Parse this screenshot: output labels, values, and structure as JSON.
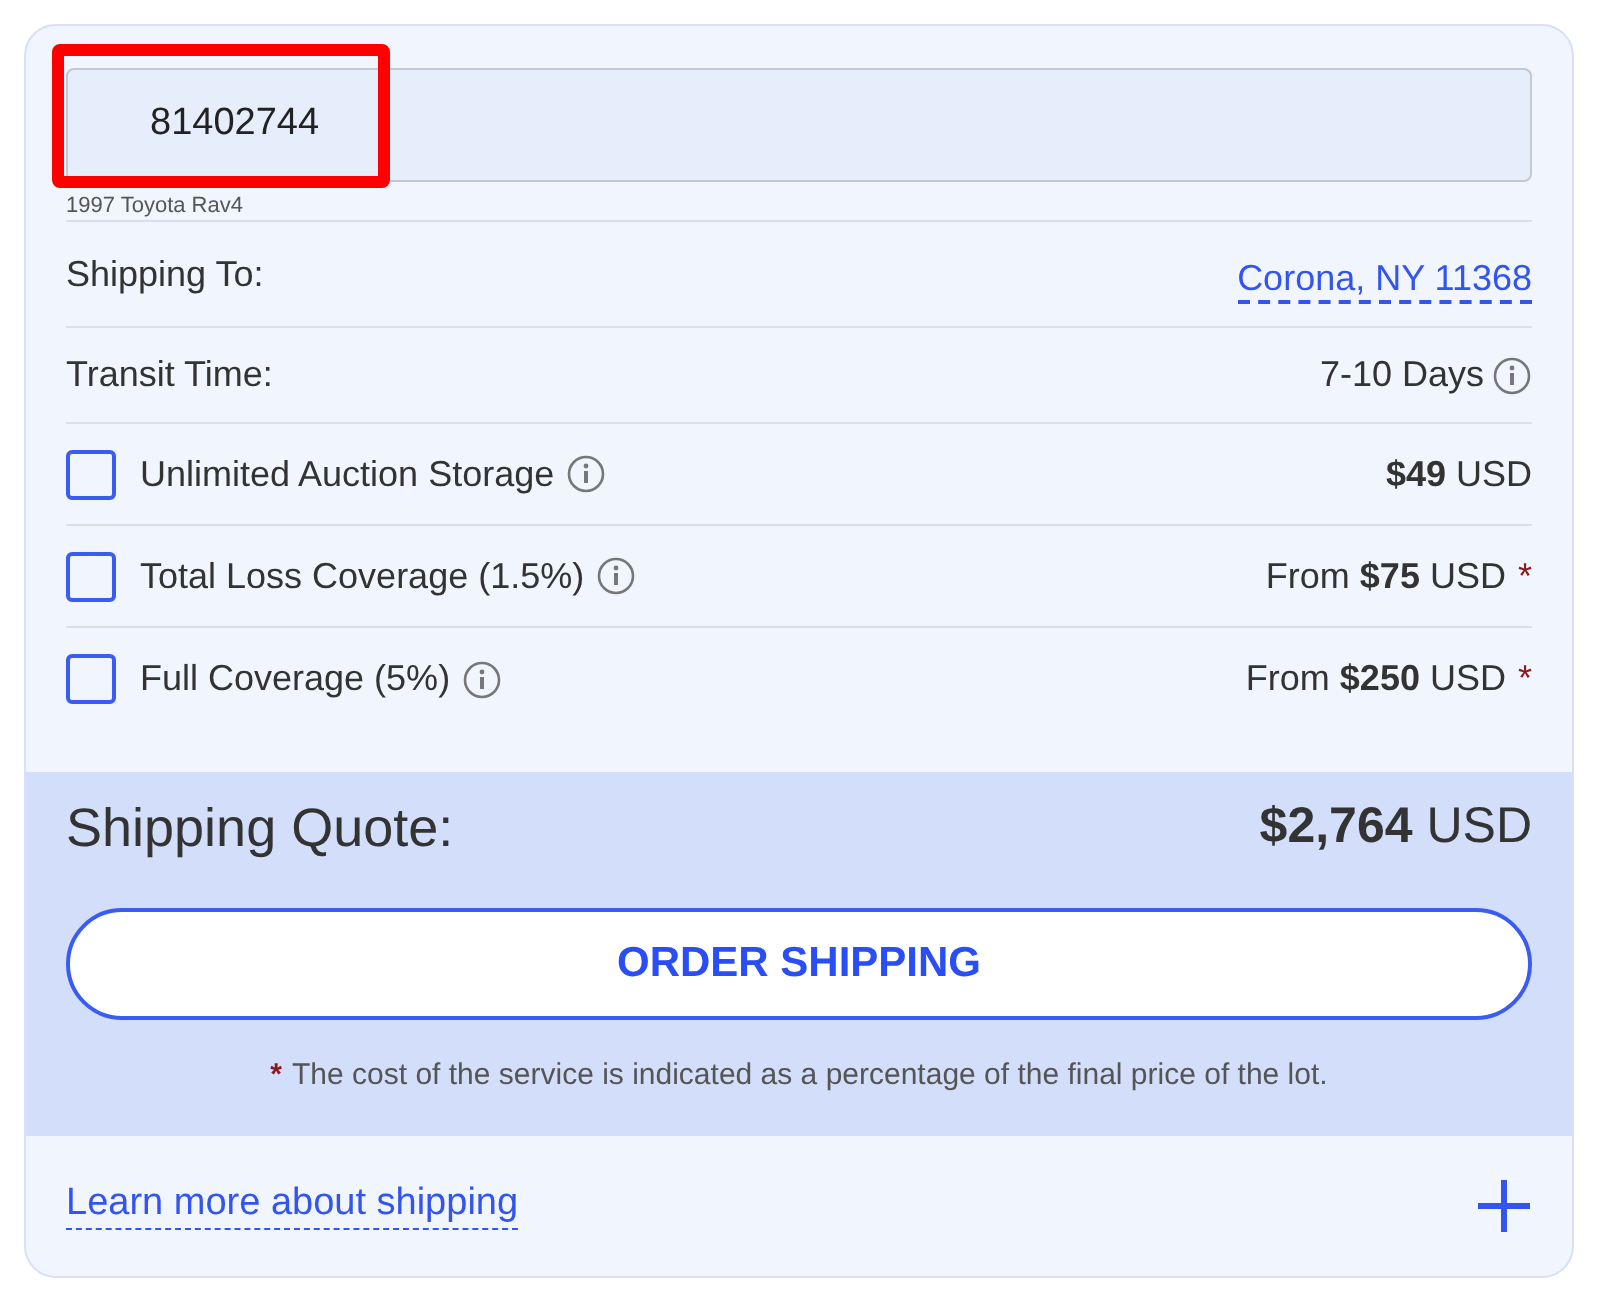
{
  "lot_field": {
    "value": "81402744",
    "highlighted": true
  },
  "vehicle": "1997 Toyota Rav4",
  "shipping_to": {
    "label": "Shipping To:",
    "value": "Corona, NY 11368"
  },
  "transit": {
    "label": "Transit Time:",
    "value": "7-10 Days"
  },
  "options": [
    {
      "label": "Unlimited Auction Storage",
      "checked": false,
      "price": "**$49** USD"
    },
    {
      "label": "Total Loss Coverage (1.5%)",
      "checked": false,
      "price": "From **$75** USD",
      "mark": "*"
    },
    {
      "label": "Full Coverage (5%)",
      "checked": false,
      "price": "From **$250** USD",
      "mark": "*"
    }
  ],
  "quote": {
    "label": "Shipping Quote:",
    "amount": "**$2,764** USD"
  },
  "order_button": "ORDER SHIPPING",
  "footnote": {
    "mark": "*",
    "text": "The cost of the service is indicated as a percentage of the final price of the lot."
  },
  "learn_more": "Learn more about shipping"
}
